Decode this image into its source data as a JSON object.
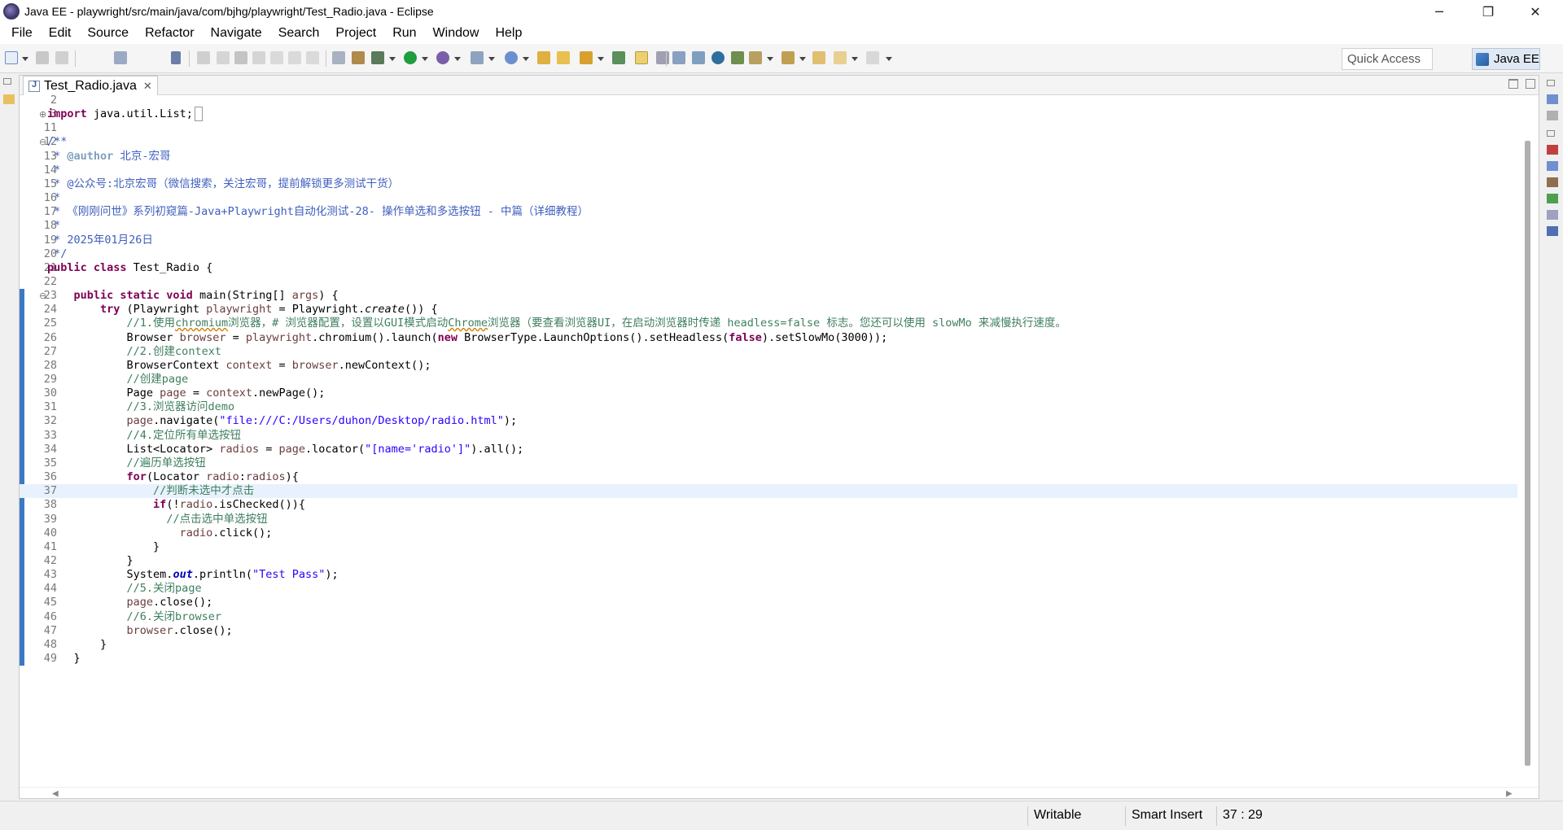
{
  "window": {
    "title": "Java EE - playwright/src/main/java/com/bjhg/playwright/Test_Radio.java - Eclipse",
    "minimize": "─",
    "restore": "❐",
    "close": "✕"
  },
  "menu": [
    "File",
    "Edit",
    "Source",
    "Refactor",
    "Navigate",
    "Search",
    "Project",
    "Run",
    "Window",
    "Help"
  ],
  "toolbar": {
    "quick_access_placeholder": "Quick Access",
    "perspective_label": "Java EE"
  },
  "editor": {
    "tab_label": "Test_Radio.java",
    "tab_close": "✕",
    "current_line": 37,
    "lines": [
      {
        "n": "2",
        "html": ""
      },
      {
        "n": "3",
        "html": "<span class=\"kw\">import</span> java.util.List;<span style=\"border:1px solid #999;margin-left:2px;\">&nbsp;</span>"
      },
      {
        "n": "11",
        "html": ""
      },
      {
        "n": "12",
        "html": "<span class=\"jd\">/**</span>"
      },
      {
        "n": "13",
        "html": "<span class=\"jd\"> * </span><span class=\"jdtag\">@author</span><span class=\"jd\"> 北京-宏哥</span>"
      },
      {
        "n": "14",
        "html": "<span class=\"jd\"> *</span>"
      },
      {
        "n": "15",
        "html": "<span class=\"jd\"> * @公众号:北京宏哥（微信搜索，关注宏哥，提前解锁更多测试干货）</span>"
      },
      {
        "n": "16",
        "html": "<span class=\"jd\"> *</span>"
      },
      {
        "n": "17",
        "html": "<span class=\"jd\"> * 《刚刚问世》系列初窥篇-Java+Playwright自动化测试-28- 操作单选和多选按钮 - 中篇（详细教程）</span>"
      },
      {
        "n": "18",
        "html": "<span class=\"jd\"> *</span>"
      },
      {
        "n": "19",
        "html": "<span class=\"jd\"> * 2025年01月26日</span>"
      },
      {
        "n": "20",
        "html": "<span class=\"jd\"> */</span>"
      },
      {
        "n": "21",
        "html": "<span class=\"kw\">public class</span> Test_Radio {"
      },
      {
        "n": "22",
        "html": ""
      },
      {
        "n": "23",
        "html": "    <span class=\"kw\">public static void</span> main(String[] <span class=\"vr\">args</span>) {"
      },
      {
        "n": "24",
        "html": "        <span class=\"kw\">try</span> (Playwright <span class=\"vr\">playwright</span> = Playwright.<span class=\"it\">create</span>()) {"
      },
      {
        "n": "25",
        "html": "            <span class=\"cm\">//1.使用<span class=\"sq\">chromium</span>浏览器，# 浏览器配置，设置以GUI模式启动<span class=\"sq\">Chrome</span>浏览器（要查看浏览器UI，在启动浏览器时传递 headless=false 标志。您还可以使用 slowMo 来减慢执行速度。</span>"
      },
      {
        "n": "26",
        "html": "            Browser <span class=\"vr\">browser</span> = <span class=\"vr\">playwright</span>.chromium().launch(<span class=\"kw\">new</span> BrowserType.LaunchOptions().setHeadless(<span class=\"kw\">false</span>).setSlowMo(3000));"
      },
      {
        "n": "27",
        "html": "            <span class=\"cm\">//2.创建context</span>"
      },
      {
        "n": "28",
        "html": "            BrowserContext <span class=\"vr\">context</span> = <span class=\"vr\">browser</span>.newContext();"
      },
      {
        "n": "29",
        "html": "            <span class=\"cm\">//创建page</span>"
      },
      {
        "n": "30",
        "html": "            Page <span class=\"vr\">page</span> = <span class=\"vr\">context</span>.newPage();"
      },
      {
        "n": "31",
        "html": "            <span class=\"cm\">//3.浏览器访问demo</span>"
      },
      {
        "n": "32",
        "html": "            <span class=\"vr\">page</span>.navigate(<span class=\"str\">\"file:///C:/Users/duhon/Desktop/radio.html\"</span>);"
      },
      {
        "n": "33",
        "html": "            <span class=\"cm\">//4.定位所有单选按钮</span>"
      },
      {
        "n": "34",
        "html": "            List&lt;Locator&gt; <span class=\"vr\">radios</span> = <span class=\"vr\">page</span>.locator(<span class=\"str\">\"[name='radio']\"</span>).all();"
      },
      {
        "n": "35",
        "html": "            <span class=\"cm\">//遍历单选按钮</span>"
      },
      {
        "n": "36",
        "html": "            <span class=\"kw\">for</span>(Locator <span class=\"vr\">radio</span>:<span class=\"vr\">radios</span>){"
      },
      {
        "n": "37",
        "html": "                <span class=\"cm\">//判断未选中才点击</span>"
      },
      {
        "n": "38",
        "html": "                <span class=\"kw\">if</span>(!<span class=\"vr\">radio</span>.isChecked()){"
      },
      {
        "n": "39",
        "html": "                  <span class=\"cm\">//点击选中单选按钮</span>"
      },
      {
        "n": "40",
        "html": "                    <span class=\"vr\">radio</span>.click();"
      },
      {
        "n": "41",
        "html": "                }"
      },
      {
        "n": "42",
        "html": "            }"
      },
      {
        "n": "43",
        "html": "            System.<span class=\"fld\">out</span>.println(<span class=\"str\">\"Test Pass\"</span>);"
      },
      {
        "n": "44",
        "html": "            <span class=\"cm\">//5.关闭page</span>"
      },
      {
        "n": "45",
        "html": "            <span class=\"vr\">page</span>.close();"
      },
      {
        "n": "46",
        "html": "            <span class=\"cm\">//6.关闭browser</span>"
      },
      {
        "n": "47",
        "html": "            <span class=\"vr\">browser</span>.close();"
      },
      {
        "n": "48",
        "html": "        }"
      },
      {
        "n": "49",
        "html": "    }"
      }
    ]
  },
  "status": {
    "writable": "Writable",
    "insert_mode": "Smart Insert",
    "position": "37 : 29"
  }
}
